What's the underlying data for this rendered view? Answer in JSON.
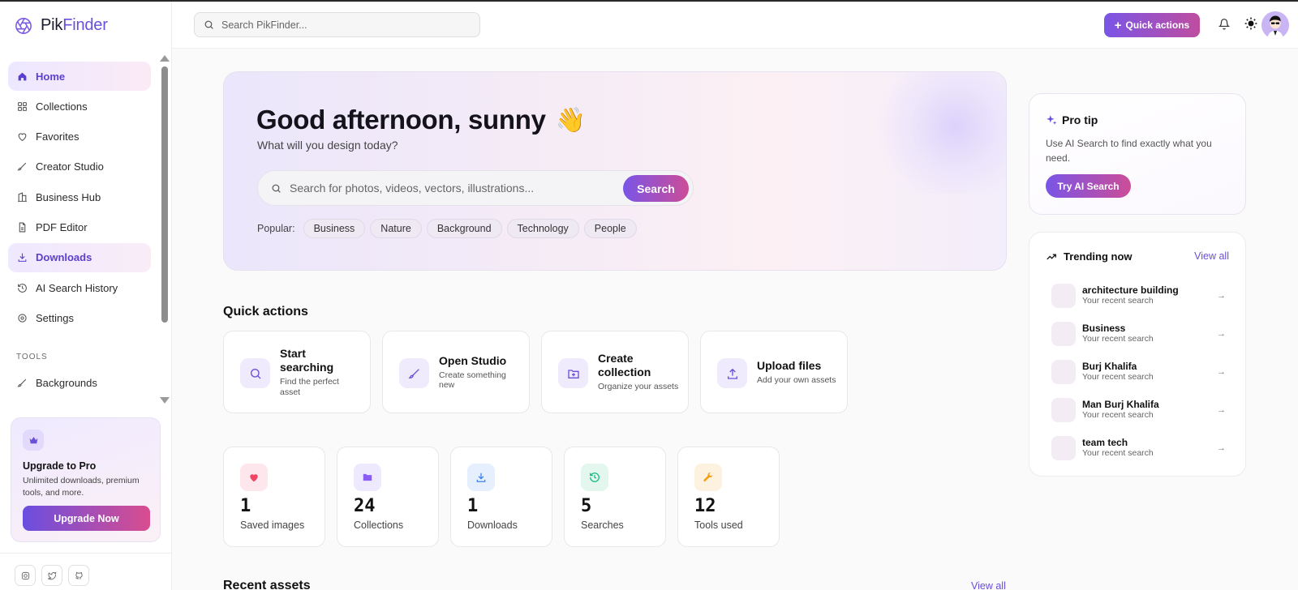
{
  "brand": {
    "part1": "Pik",
    "part2": "Finder"
  },
  "sidebar": {
    "items": [
      {
        "label": "Home",
        "icon": "home-icon"
      },
      {
        "label": "Collections",
        "icon": "grid-icon"
      },
      {
        "label": "Favorites",
        "icon": "heart-icon"
      },
      {
        "label": "Creator Studio",
        "icon": "brush-icon"
      },
      {
        "label": "Business Hub",
        "icon": "building-icon"
      },
      {
        "label": "PDF Editor",
        "icon": "file-icon"
      },
      {
        "label": "Downloads",
        "icon": "download-icon"
      },
      {
        "label": "AI Search History",
        "icon": "history-icon"
      },
      {
        "label": "Settings",
        "icon": "gear-icon"
      }
    ],
    "tools_label": "TOOLS",
    "tools": [
      {
        "label": "Backgrounds",
        "icon": "brush-icon"
      }
    ],
    "upgrade": {
      "title": "Upgrade to Pro",
      "desc": "Unlimited downloads, premium tools, and more.",
      "button": "Upgrade Now"
    }
  },
  "topbar": {
    "search_placeholder": "Search PikFinder...",
    "quick_actions": "Quick actions"
  },
  "hero": {
    "greeting": "Good afternoon, sunny",
    "emoji": "👋",
    "subtitle": "What will you design today?",
    "search_placeholder": "Search for photos, videos, vectors, illustrations...",
    "search_button": "Search",
    "popular_label": "Popular:",
    "popular": [
      "Business",
      "Nature",
      "Background",
      "Technology",
      "People"
    ]
  },
  "quick_actions": {
    "title": "Quick actions",
    "cards": [
      {
        "title": "Start searching",
        "desc": "Find the perfect asset",
        "icon": "search-icon"
      },
      {
        "title": "Open Studio",
        "desc": "Create something new",
        "icon": "brush-icon"
      },
      {
        "title": "Create collection",
        "desc": "Organize your assets",
        "icon": "folder-plus-icon"
      },
      {
        "title": "Upload files",
        "desc": "Add your own assets",
        "icon": "upload-icon"
      }
    ]
  },
  "stats": [
    {
      "value": "1",
      "label": "Saved images",
      "icon": "heart-icon",
      "color": "#ef4462"
    },
    {
      "value": "24",
      "label": "Collections",
      "icon": "folder-icon",
      "color": "#8b5cf6"
    },
    {
      "value": "1",
      "label": "Downloads",
      "icon": "download-icon",
      "color": "#3b82f6"
    },
    {
      "value": "5",
      "label": "Searches",
      "icon": "history-icon",
      "color": "#10b981"
    },
    {
      "value": "12",
      "label": "Tools used",
      "icon": "wrench-icon",
      "color": "#f59e0b"
    }
  ],
  "recent": {
    "title": "Recent assets",
    "view_all": "View all"
  },
  "protip": {
    "title": "Pro tip",
    "desc": "Use AI Search to find exactly what you need.",
    "button": "Try AI Search"
  },
  "trending": {
    "title": "Trending now",
    "view_all": "View all",
    "items": [
      {
        "name": "architecture building",
        "sub": "Your recent search"
      },
      {
        "name": "Business",
        "sub": "Your recent search"
      },
      {
        "name": "Burj Khalifa",
        "sub": "Your recent search"
      },
      {
        "name": "Man Burj Khalifa",
        "sub": "Your recent search"
      },
      {
        "name": "team tech",
        "sub": "Your recent search"
      }
    ]
  },
  "colors": {
    "accent": "#6b4fd8",
    "accent_pink": "#cc4d98"
  }
}
